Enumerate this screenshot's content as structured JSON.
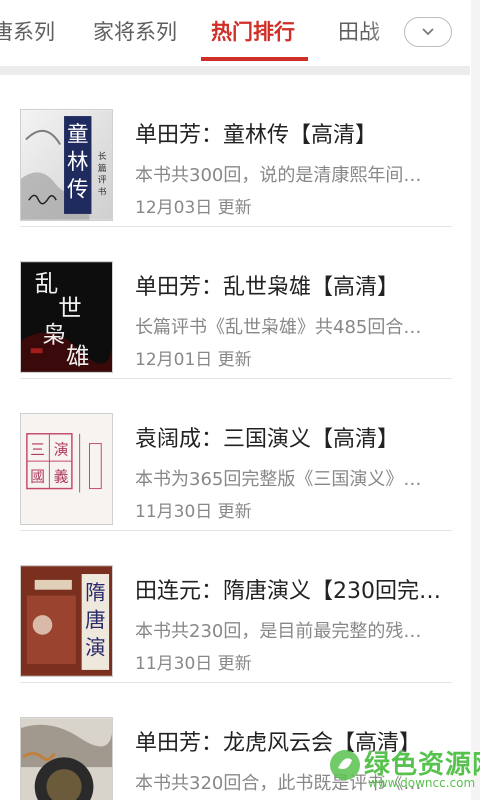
{
  "tabs": [
    {
      "label": "唐系列",
      "active": false
    },
    {
      "label": "家将系列",
      "active": false
    },
    {
      "label": "热门排行",
      "active": true
    },
    {
      "label": "田战",
      "active": false
    }
  ],
  "colors": {
    "accent": "#d02f27",
    "text_secondary": "#888888",
    "watermark": "#58c24e"
  },
  "items": [
    {
      "title": "单田芳：童林传【高清】",
      "desc": "本书共300回，说的是清康熙年间…",
      "date": "12月03日 更新",
      "cover_icon": "tonglinzhuan-cover-image"
    },
    {
      "title": "单田芳：乱世枭雄【高清】",
      "desc": "长篇评书《乱世枭雄》共485回合…",
      "date": "12月01日 更新",
      "cover_icon": "luanshixiaoxiong-cover-image"
    },
    {
      "title": "袁阔成：三国演义【高清】",
      "desc": "本书为365回完整版《三国演义》…",
      "date": "11月30日 更新",
      "cover_icon": "sanguoyanyi-cover-image"
    },
    {
      "title": "田连元：隋唐演义【230回完…",
      "desc": "本书共230回，是目前最完整的残…",
      "date": "11月30日 更新",
      "cover_icon": "suitangyanyi-cover-image"
    },
    {
      "title": "单田芳：龙虎风云会【高清】",
      "desc": "本书共320回合，此书既是评书《…",
      "date": "",
      "cover_icon": "longhufengyunhui-cover-image"
    }
  ],
  "watermark": {
    "text": "绿色资源网",
    "url": "www.downcc.com"
  }
}
